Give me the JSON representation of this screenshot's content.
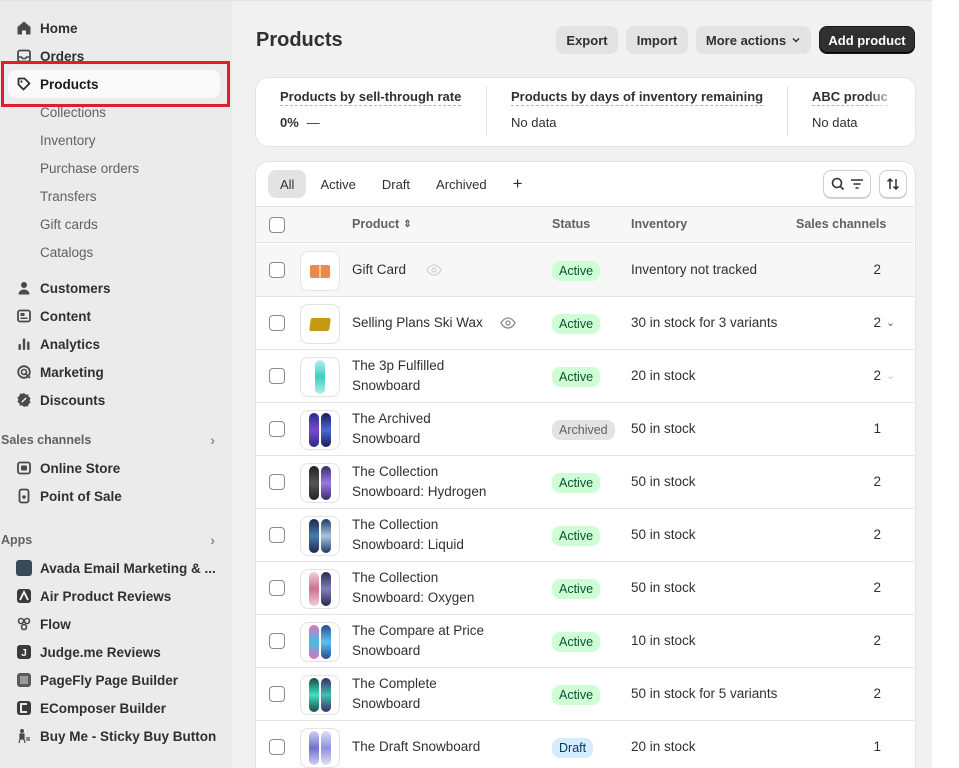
{
  "sidebar": {
    "items": [
      {
        "label": "Home",
        "icon": "home-icon"
      },
      {
        "label": "Orders",
        "icon": "inbox-icon"
      },
      {
        "label": "Products",
        "icon": "tag-icon"
      },
      {
        "label": "Collections"
      },
      {
        "label": "Inventory"
      },
      {
        "label": "Purchase orders"
      },
      {
        "label": "Transfers"
      },
      {
        "label": "Gift cards"
      },
      {
        "label": "Catalogs"
      },
      {
        "label": "Customers",
        "icon": "person-icon"
      },
      {
        "label": "Content",
        "icon": "content-icon"
      },
      {
        "label": "Analytics",
        "icon": "bar-chart-icon"
      },
      {
        "label": "Marketing",
        "icon": "target-icon"
      },
      {
        "label": "Discounts",
        "icon": "discount-icon"
      }
    ],
    "sales_channels_title": "Sales channels",
    "sales_channels": [
      {
        "label": "Online Store",
        "icon": "store-icon"
      },
      {
        "label": "Point of Sale",
        "icon": "pos-icon"
      }
    ],
    "apps_title": "Apps",
    "apps": [
      {
        "label": "Avada Email Marketing & ..."
      },
      {
        "label": "Air Product Reviews"
      },
      {
        "label": "Flow"
      },
      {
        "label": "Judge.me Reviews"
      },
      {
        "label": "PageFly Page Builder"
      },
      {
        "label": "EComposer Builder"
      },
      {
        "label": "Buy Me - Sticky Buy Button"
      }
    ]
  },
  "header": {
    "title": "Products",
    "export_label": "Export",
    "import_label": "Import",
    "more_actions_label": "More actions",
    "add_product_label": "Add product"
  },
  "metrics": [
    {
      "title": "Products by sell-through rate",
      "value": "0%",
      "suffix": "—"
    },
    {
      "title": "Products by days of inventory remaining",
      "value": "No data"
    },
    {
      "title": "ABC produc",
      "value": "No data"
    }
  ],
  "tabs": [
    "All",
    "Active",
    "Draft",
    "Archived",
    "+"
  ],
  "table": {
    "columns": {
      "product": "Product",
      "status": "Status",
      "inventory": "Inventory",
      "sales_channels": "Sales channels"
    },
    "rows": [
      {
        "name": "Gift Card",
        "status": "Active",
        "inventory": "Inventory not tracked",
        "channels": "2"
      },
      {
        "name": "Selling Plans Ski Wax",
        "status": "Active",
        "inventory": "30 in stock for 3 variants",
        "channels": "2"
      },
      {
        "name": "The 3p Fulfilled Snowboard",
        "status": "Active",
        "inventory": "20 in stock",
        "channels": "2"
      },
      {
        "name": "The Archived Snowboard",
        "status": "Archived",
        "inventory": "50 in stock",
        "channels": "1"
      },
      {
        "name": "The Collection Snowboard: Hydrogen",
        "status": "Active",
        "inventory": "50 in stock",
        "channels": "2"
      },
      {
        "name": "The Collection Snowboard: Liquid",
        "status": "Active",
        "inventory": "50 in stock",
        "channels": "2"
      },
      {
        "name": "The Collection Snowboard: Oxygen",
        "status": "Active",
        "inventory": "50 in stock",
        "channels": "2"
      },
      {
        "name": "The Compare at Price Snowboard",
        "status": "Active",
        "inventory": "10 in stock",
        "channels": "2"
      },
      {
        "name": "The Complete Snowboard",
        "status": "Active",
        "inventory": "50 in stock for 5 variants",
        "channels": "2"
      },
      {
        "name": "The Draft Snowboard",
        "status": "Draft",
        "inventory": "20 in stock",
        "channels": "1"
      }
    ]
  },
  "colors": {
    "highlight": "#e01e2b",
    "active_badge": "#cdfed4",
    "draft_badge": "#d5ebff",
    "primary_button": "#303030"
  }
}
